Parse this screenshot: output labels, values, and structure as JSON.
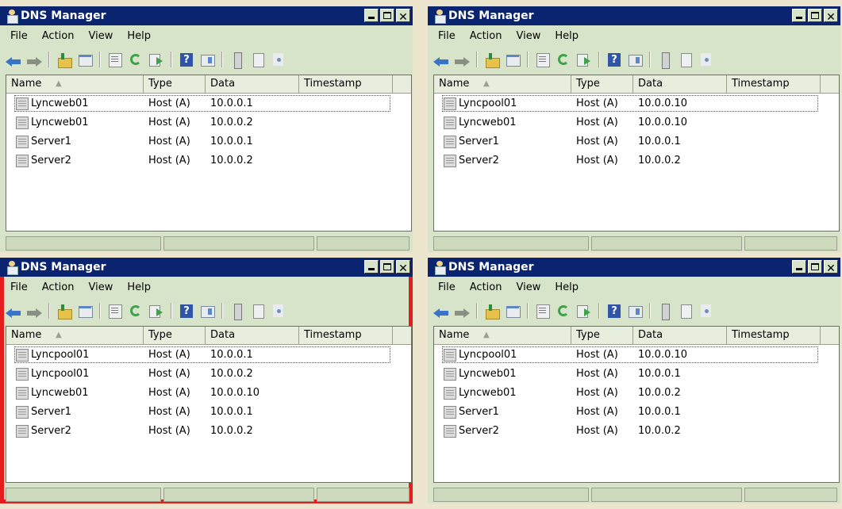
{
  "windows": [
    {
      "title": "DNS Manager",
      "selected": false,
      "menu": [
        "File",
        "Action",
        "View",
        "Help"
      ],
      "columns": [
        "Name",
        "Type",
        "Data",
        "Timestamp"
      ],
      "rows": [
        {
          "name": "Lyncweb01",
          "type": "Host (A)",
          "data": "10.0.0.1"
        },
        {
          "name": "Lyncweb01",
          "type": "Host (A)",
          "data": "10.0.0.2"
        },
        {
          "name": "Server1",
          "type": "Host (A)",
          "data": "10.0.0.1"
        },
        {
          "name": "Server2",
          "type": "Host (A)",
          "data": "10.0.0.2"
        }
      ]
    },
    {
      "title": "DNS Manager",
      "selected": false,
      "menu": [
        "File",
        "Action",
        "View",
        "Help"
      ],
      "columns": [
        "Name",
        "Type",
        "Data",
        "Timestamp"
      ],
      "rows": [
        {
          "name": "Lyncpool01",
          "type": "Host (A)",
          "data": "10.0.0.10"
        },
        {
          "name": "Lyncweb01",
          "type": "Host (A)",
          "data": "10.0.0.10"
        },
        {
          "name": "Server1",
          "type": "Host (A)",
          "data": "10.0.0.1"
        },
        {
          "name": "Server2",
          "type": "Host (A)",
          "data": "10.0.0.2"
        }
      ]
    },
    {
      "title": "DNS Manager",
      "selected": true,
      "menu": [
        "File",
        "Action",
        "View",
        "Help"
      ],
      "columns": [
        "Name",
        "Type",
        "Data",
        "Timestamp"
      ],
      "rows": [
        {
          "name": "Lyncpool01",
          "type": "Host (A)",
          "data": "10.0.0.1"
        },
        {
          "name": "Lyncpool01",
          "type": "Host (A)",
          "data": "10.0.0.2"
        },
        {
          "name": "Lyncweb01",
          "type": "Host (A)",
          "data": "10.0.0.10"
        },
        {
          "name": "Server1",
          "type": "Host (A)",
          "data": "10.0.0.1"
        },
        {
          "name": "Server2",
          "type": "Host (A)",
          "data": "10.0.0.2"
        }
      ]
    },
    {
      "title": "DNS Manager",
      "selected": false,
      "menu": [
        "File",
        "Action",
        "View",
        "Help"
      ],
      "columns": [
        "Name",
        "Type",
        "Data",
        "Timestamp"
      ],
      "rows": [
        {
          "name": "Lyncpool01",
          "type": "Host (A)",
          "data": "10.0.0.10"
        },
        {
          "name": "Lyncweb01",
          "type": "Host (A)",
          "data": "10.0.0.1"
        },
        {
          "name": "Lyncweb01",
          "type": "Host (A)",
          "data": "10.0.0.2"
        },
        {
          "name": "Server1",
          "type": "Host (A)",
          "data": "10.0.0.1"
        },
        {
          "name": "Server2",
          "type": "Host (A)",
          "data": "10.0.0.2"
        }
      ]
    }
  ],
  "colors": {
    "titlebar": "#0a2470",
    "window_bg": "#d8e4c9",
    "selection_border": "#e51d1d"
  }
}
